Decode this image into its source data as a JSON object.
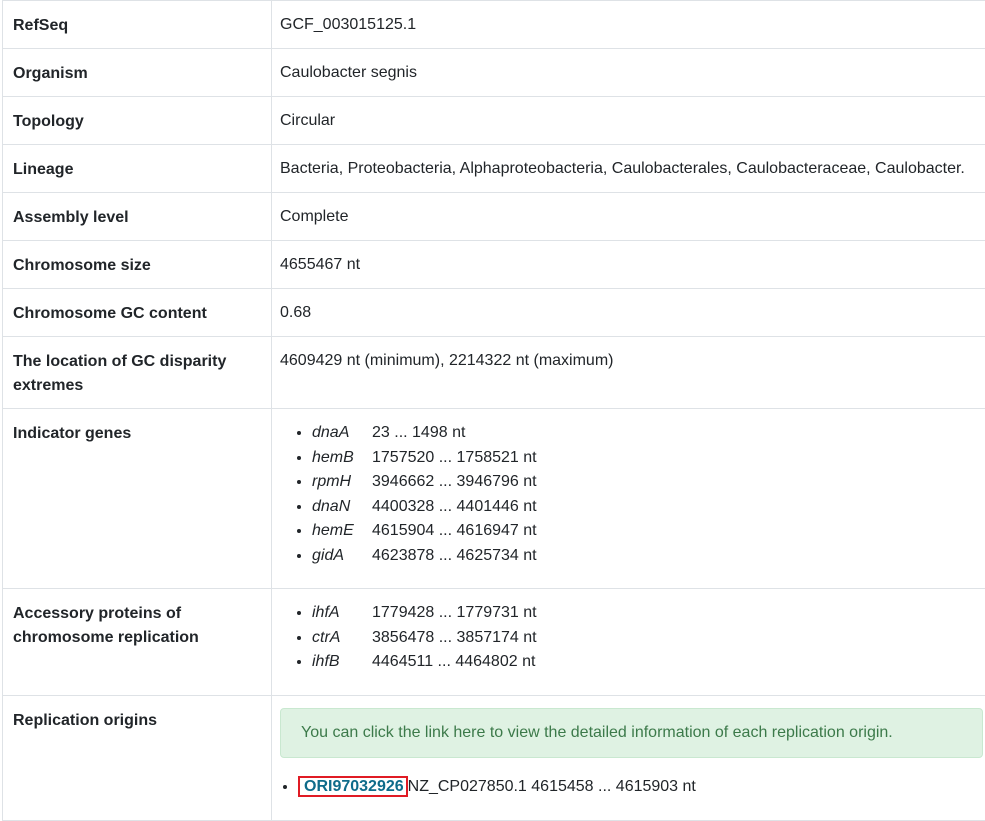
{
  "rows": {
    "refseq": {
      "label": "RefSeq",
      "value": "GCF_003015125.1"
    },
    "organism": {
      "label": "Organism",
      "value": "Caulobacter segnis"
    },
    "topology": {
      "label": "Topology",
      "value": "Circular"
    },
    "lineage": {
      "label": "Lineage",
      "value": "Bacteria, Proteobacteria, Alphaproteobacteria, Caulobacterales, Caulobacteraceae, Caulobacter."
    },
    "assembly_level": {
      "label": "Assembly level",
      "value": "Complete"
    },
    "chromosome_size": {
      "label": "Chromosome size",
      "value": "4655467 nt"
    },
    "gc_content": {
      "label": "Chromosome GC content",
      "value": "0.68"
    },
    "gc_disparity": {
      "label": "The location of GC disparity extremes",
      "value": "4609429 nt (minimum), 2214322 nt (maximum)"
    }
  },
  "indicator_genes": {
    "label": "Indicator genes",
    "items": [
      {
        "name": "dnaA",
        "range": "23 ... 1498 nt"
      },
      {
        "name": "hemB",
        "range": "1757520 ... 1758521 nt"
      },
      {
        "name": "rpmH",
        "range": "3946662 ... 3946796 nt"
      },
      {
        "name": "dnaN",
        "range": "4400328 ... 4401446 nt"
      },
      {
        "name": "hemE",
        "range": "4615904 ... 4616947 nt"
      },
      {
        "name": "gidA",
        "range": "4623878 ... 4625734 nt"
      }
    ]
  },
  "accessory_proteins": {
    "label": "Accessory proteins of chromosome replication",
    "items": [
      {
        "name": "ihfA",
        "range": "1779428 ... 1779731 nt"
      },
      {
        "name": "ctrA",
        "range": "3856478 ... 3857174 nt"
      },
      {
        "name": "ihfB",
        "range": "4464511 ... 4464802 nt"
      }
    ]
  },
  "replication_origins": {
    "label": "Replication origins",
    "notice": "You can click the link here to view the detailed information of each replication origin.",
    "items": [
      {
        "id": "ORI97032926",
        "text": "NZ_CP027850.1 4615458 ... 4615903 nt"
      }
    ]
  }
}
